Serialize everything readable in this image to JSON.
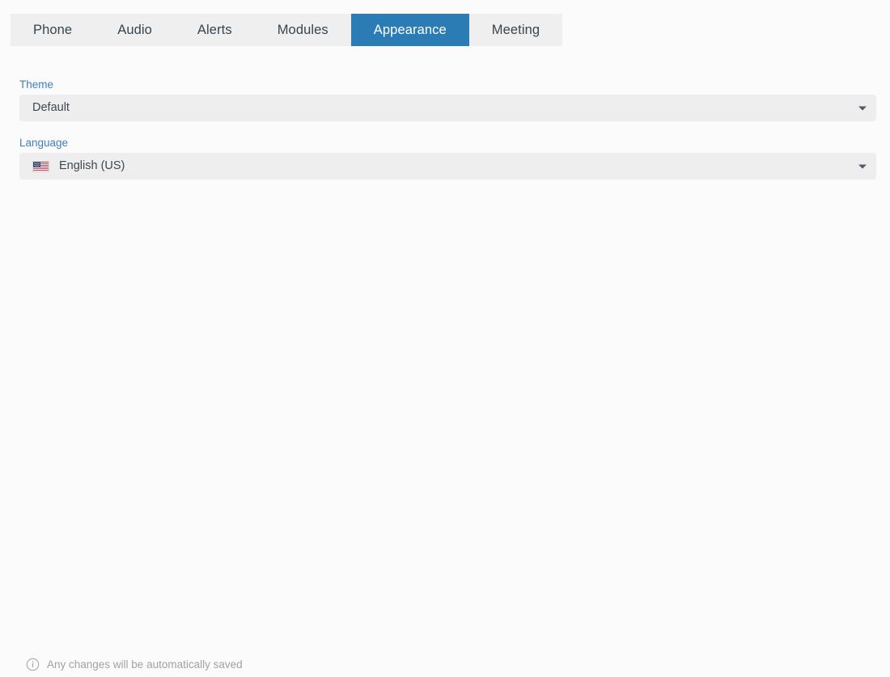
{
  "tabs": [
    {
      "label": "Phone",
      "active": false
    },
    {
      "label": "Audio",
      "active": false
    },
    {
      "label": "Alerts",
      "active": false
    },
    {
      "label": "Modules",
      "active": false
    },
    {
      "label": "Appearance",
      "active": true
    },
    {
      "label": "Meeting",
      "active": false
    }
  ],
  "settings": {
    "theme": {
      "label": "Theme",
      "value": "Default",
      "icon": "chevron-down-icon"
    },
    "language": {
      "label": "Language",
      "value": "English (US)",
      "flag_icon": "us-flag-icon",
      "icon": "chevron-down-icon"
    }
  },
  "footer": {
    "icon": "info-circle-icon",
    "text": "Any changes will be automatically saved"
  },
  "colors": {
    "accent": "#2b7cb4",
    "label": "#3f7fbf",
    "field_bg": "#eeeeee",
    "tabbar_bg": "#efefef",
    "page_bg": "#fbfbfb",
    "text": "#3d4852",
    "muted_text": "#a2a2a2"
  }
}
